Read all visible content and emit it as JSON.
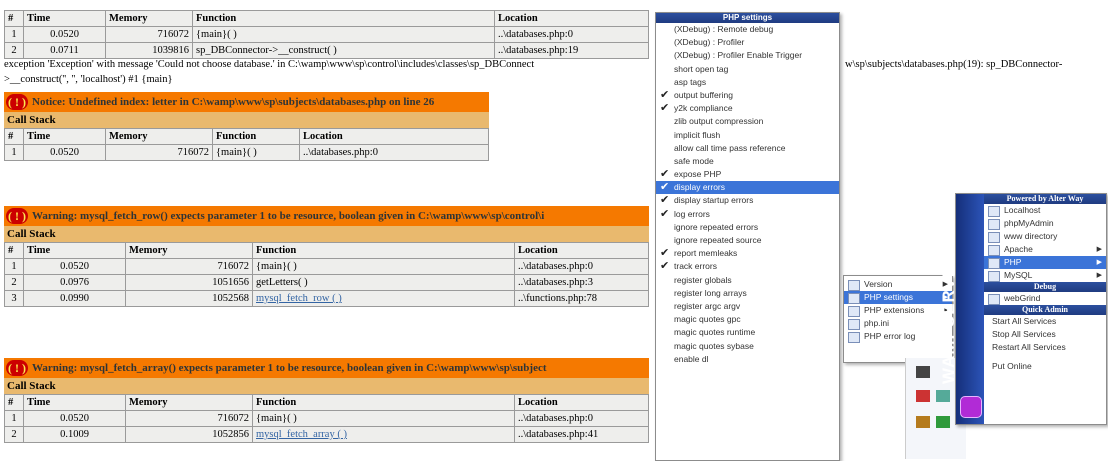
{
  "table1": {
    "headers": [
      "#",
      "Time",
      "Memory",
      "Function",
      "Location"
    ],
    "rows": [
      [
        "1",
        "0.0520",
        "716072",
        "{main}( )",
        "..\\databases.php:0"
      ],
      [
        "2",
        "0.0711",
        "1039816",
        "sp_DBConnector->__construct( )",
        "..\\databases.php:19"
      ]
    ]
  },
  "exception_line1": "exception 'Exception' with message 'Could not choose database.' in C:\\wamp\\www\\sp\\control\\includes\\classes\\sp_DBConnect",
  "exception_line1_right": "w\\sp\\subjects\\databases.php(19): sp_DBConnector-",
  "exception_line2": ">__construct('', '', 'localhost') #1 {main}",
  "notice": {
    "bang": "( ! )",
    "text": "Notice: Undefined index: letter in C:\\wamp\\www\\sp\\subjects\\databases.php on line 26",
    "callstack": "Call Stack",
    "headers": [
      "#",
      "Time",
      "Memory",
      "Function",
      "Location"
    ],
    "rows": [
      [
        "1",
        "0.0520",
        "716072",
        "{main}( )",
        "..\\databases.php:0"
      ]
    ]
  },
  "warning1": {
    "bang": "( ! )",
    "text": "Warning: mysql_fetch_row() expects parameter 1 to be resource, boolean given in C:\\wamp\\www\\sp\\control\\i",
    "callstack": "Call Stack",
    "headers": [
      "#",
      "Time",
      "Memory",
      "Function",
      "Location"
    ],
    "rows": [
      [
        "1",
        "0.0520",
        "716072",
        "{main}( )",
        "..\\databases.php:0"
      ],
      [
        "2",
        "0.0976",
        "1051656",
        "getLetters( )",
        "..\\databases.php:3"
      ],
      [
        "3",
        "0.0990",
        "1052568",
        "mysql_fetch_row ( )",
        "..\\functions.php:78"
      ]
    ]
  },
  "warning2": {
    "bang": "( ! )",
    "text": "Warning: mysql_fetch_array() expects parameter 1 to be resource, boolean given in C:\\wamp\\www\\sp\\subject",
    "callstack": "Call Stack",
    "headers": [
      "#",
      "Time",
      "Memory",
      "Function",
      "Location"
    ],
    "rows": [
      [
        "1",
        "0.0520",
        "716072",
        "{main}( )",
        "..\\databases.php:0"
      ],
      [
        "2",
        "0.1009",
        "1052856",
        "mysql_fetch_array ( )",
        "..\\databases.php:41"
      ]
    ]
  },
  "php_menu": {
    "title": "PHP settings",
    "items": [
      {
        "label": "(XDebug) : Remote debug",
        "checked": false
      },
      {
        "label": "(XDebug) : Profiler",
        "checked": false
      },
      {
        "label": "(XDebug) : Profiler Enable Trigger",
        "checked": false
      },
      {
        "label": "short open tag",
        "checked": false
      },
      {
        "label": "asp tags",
        "checked": false
      },
      {
        "label": "output buffering",
        "checked": true
      },
      {
        "label": "y2k compliance",
        "checked": true
      },
      {
        "label": "zlib output compression",
        "checked": false
      },
      {
        "label": "implicit flush",
        "checked": false
      },
      {
        "label": "allow call time pass reference",
        "checked": false
      },
      {
        "label": "safe mode",
        "checked": false
      },
      {
        "label": "expose PHP",
        "checked": true
      },
      {
        "label": "display errors",
        "checked": true,
        "selected": true
      },
      {
        "label": "display startup errors",
        "checked": true
      },
      {
        "label": "log errors",
        "checked": true
      },
      {
        "label": "ignore repeated errors",
        "checked": false
      },
      {
        "label": "ignore repeated source",
        "checked": false
      },
      {
        "label": "report memleaks",
        "checked": true
      },
      {
        "label": "track errors",
        "checked": true
      },
      {
        "label": "register globals",
        "checked": false
      },
      {
        "label": "register long arrays",
        "checked": false
      },
      {
        "label": "register argc argv",
        "checked": false
      },
      {
        "label": "magic quotes gpc",
        "checked": false
      },
      {
        "label": "magic quotes runtime",
        "checked": false
      },
      {
        "label": "magic quotes sybase",
        "checked": false
      },
      {
        "label": "enable dl",
        "checked": false
      }
    ]
  },
  "php_submenu": {
    "items": [
      {
        "label": "Version",
        "arrow": true
      },
      {
        "label": "PHP settings",
        "arrow": true,
        "selected": true
      },
      {
        "label": "PHP extensions",
        "arrow": true
      },
      {
        "label": "php.ini",
        "arrow": false
      },
      {
        "label": "PHP error log",
        "arrow": false
      }
    ]
  },
  "wamp_menu": {
    "brand": "WAMPSERVER 2.2",
    "header": "Powered by Alter Way",
    "items": [
      {
        "label": "Localhost",
        "arrow": false
      },
      {
        "label": "phpMyAdmin",
        "arrow": false
      },
      {
        "label": "www directory",
        "arrow": false
      },
      {
        "label": "Apache",
        "arrow": true
      },
      {
        "label": "PHP",
        "arrow": true,
        "selected": true
      },
      {
        "label": "MySQL",
        "arrow": true
      }
    ],
    "debug_header": "Debug",
    "debug_items": [
      {
        "label": "webGrind"
      }
    ],
    "quick_header": "Quick Admin",
    "quick_items": [
      {
        "label": "Start All Services"
      },
      {
        "label": "Stop All Services"
      },
      {
        "label": "Restart All Services"
      }
    ],
    "online_label": "Put Online"
  }
}
